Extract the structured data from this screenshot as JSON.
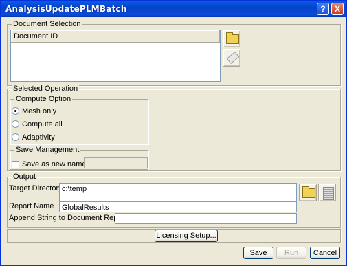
{
  "window": {
    "title": "AnalysisUpdatePLMBatch",
    "help_label": "?",
    "close_label": "X"
  },
  "document_selection": {
    "legend": "Document Selection",
    "column_header": "Document ID",
    "browse_icon": "folder-icon",
    "clear_icon": "eraser-icon"
  },
  "selected_operation": {
    "legend": "Selected Operation",
    "compute_option": {
      "legend": "Compute Option",
      "options": [
        {
          "label": "Mesh only",
          "selected": true
        },
        {
          "label": "Compute all",
          "selected": false
        },
        {
          "label": "Adaptivity",
          "selected": false
        }
      ]
    },
    "save_management": {
      "legend": "Save Management",
      "save_as_label": "Save as new name:",
      "save_as_checked": false,
      "save_as_value": ""
    }
  },
  "output": {
    "legend": "Output",
    "target_directory_label": "Target Directory",
    "target_directory_value": "c:\\temp",
    "report_name_label": "Report Name",
    "report_name_value": "GlobalResults",
    "append_label": "Append String to Document Report",
    "append_value": ""
  },
  "buttons": {
    "licensing": "Licensing Setup...",
    "save": "Save",
    "run": "Run",
    "cancel": "Cancel"
  }
}
